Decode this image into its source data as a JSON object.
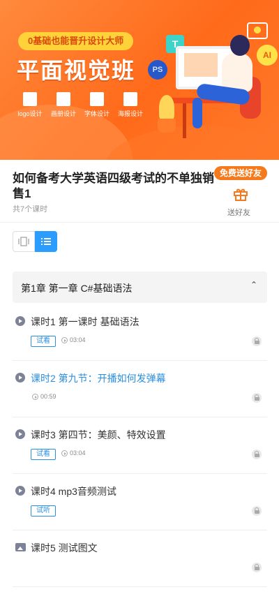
{
  "banner": {
    "tagline": "0基础也能晋升设计大师",
    "headline": "平面视觉班",
    "features": [
      "logo设计",
      "画册设计",
      "字体设计",
      "海报设计"
    ],
    "ps_badge": "PS",
    "ai_badge": "AI",
    "t_badge": "T",
    "colors": {
      "primary": "#ff6a1a",
      "accent": "#ffd23a"
    }
  },
  "course": {
    "title": "如何备考大学英语四级考试的不单独销售1",
    "subtitle": "共7个课时",
    "gift_button": "免费送好友",
    "gift_label": "送好友"
  },
  "view_toggle": {
    "active": "list",
    "active_color": "#2b9dff"
  },
  "chapter": {
    "title": "第1章 第一章 C#基础语法",
    "expanded": true
  },
  "lessons": [
    {
      "icon": "play-icon",
      "title": "课时1 第一课时 基础语法",
      "tag": "试看",
      "duration": "03:04",
      "active": false
    },
    {
      "icon": "play-icon",
      "title": "课时2 第九节：开播如何发弹幕",
      "tag": "",
      "duration": "00:59",
      "active": true
    },
    {
      "icon": "play-icon",
      "title": "课时3 第四节：美颜、特效设置",
      "tag": "试看",
      "duration": "03:04",
      "active": false
    },
    {
      "icon": "play-icon",
      "title": "课时4 mp3音频测试",
      "tag": "试听",
      "duration": "",
      "active": false
    },
    {
      "icon": "image-icon",
      "title": "课时5 测试图文",
      "tag": "",
      "duration": "",
      "active": false
    }
  ]
}
